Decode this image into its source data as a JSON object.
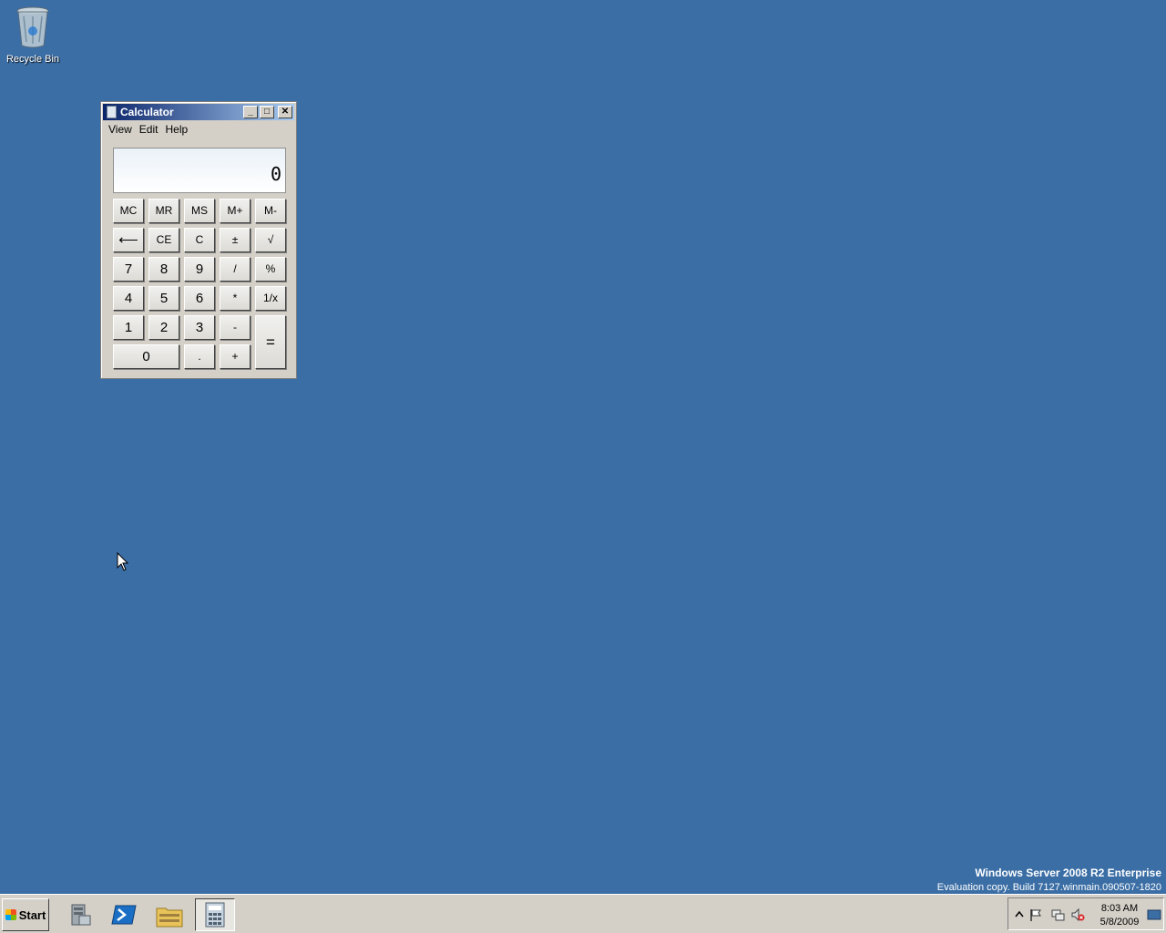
{
  "desktop": {
    "recycle_bin_label": "Recycle Bin"
  },
  "calculator": {
    "title": "Calculator",
    "menu": [
      "View",
      "Edit",
      "Help"
    ],
    "display_value": "0",
    "keys": {
      "mc": "MC",
      "mr": "MR",
      "ms": "MS",
      "mplus": "M+",
      "mminus": "M-",
      "backspace": "⟵",
      "ce": "CE",
      "c": "C",
      "plusminus": "±",
      "sqrt": "√",
      "seven": "7",
      "eight": "8",
      "nine": "9",
      "divide": "/",
      "percent": "%",
      "four": "4",
      "five": "5",
      "six": "6",
      "multiply": "*",
      "reciprocal": "1/x",
      "one": "1",
      "two": "2",
      "three": "3",
      "minus": "-",
      "equals": "=",
      "zero": "0",
      "decimal": ".",
      "plus": "+"
    },
    "window_buttons": {
      "minimize": "_",
      "maximize": "□",
      "close": "✕"
    }
  },
  "system_info": {
    "edition": "Windows Server 2008 R2 Enterprise",
    "build": "Evaluation copy. Build 7127.winmain.090507-1820"
  },
  "taskbar": {
    "start_label": "Start",
    "apps": [
      "server-manager-icon",
      "powershell-icon",
      "explorer-icon",
      "calculator-icon"
    ],
    "clock_time": "8:03 AM",
    "clock_date": "5/8/2009"
  },
  "colors": {
    "desktop": "#3b6ea5",
    "title_start": "#0a246a",
    "title_end": "#a6caf0",
    "chrome": "#d4d0c8"
  }
}
